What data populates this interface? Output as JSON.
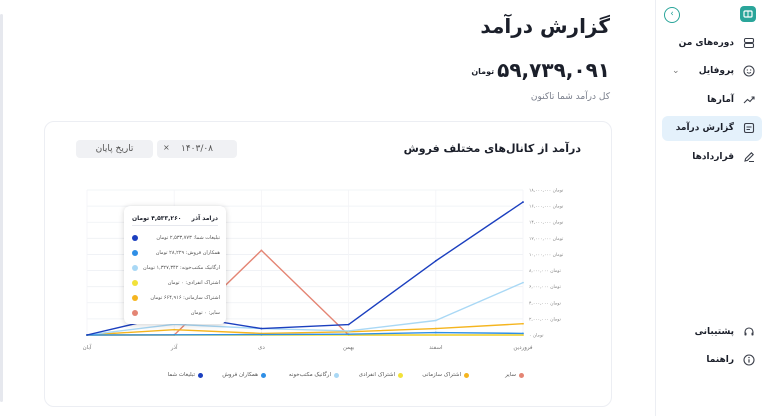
{
  "page": {
    "title": "گزارش درآمد",
    "amount": "۵۹,۷۳۹,۰۹۱",
    "currency": "تومان",
    "subtitle": "کل درآمد شما تاکنون"
  },
  "sidebar": {
    "logo_icon": "book-logo-icon",
    "collapse_icon": "chevron-right-icon",
    "items": [
      {
        "label": "دوره‌های من",
        "icon": "stack-icon"
      },
      {
        "label": "پروفایل",
        "icon": "smile-icon"
      },
      {
        "label": "آمارها",
        "icon": "trend-icon"
      },
      {
        "label": "گزارش درآمد",
        "icon": "report-icon"
      },
      {
        "label": "قراردادها",
        "icon": "pen-icon"
      }
    ],
    "bottom": [
      {
        "label": "پشتیبانی",
        "icon": "headset-icon"
      },
      {
        "label": "راهنما",
        "icon": "info-icon"
      }
    ]
  },
  "card": {
    "title": "درآمد از کانال‌های مختلف فروش",
    "start_date": "۱۴۰۳/۰۸",
    "end_date_placeholder": "تاریخ پایان",
    "clear_icon": "×"
  },
  "tooltip": {
    "title": "درامد آذر",
    "total": "۴,۵۳۳,۲۶۰ تومان",
    "rows": [
      {
        "text": "تبلیغات شما:  ۲,۵۳۳,۷۷۳ تومان",
        "color": "#1b3fbf"
      },
      {
        "text": "همکاران فروش:  ۲۸,۲۲۹ تومان",
        "color": "#2f8fe6"
      },
      {
        "text": "ارگانیک مکتب‌خونه:  ۱,۳۲۷,۳۴۲ تومان",
        "color": "#a9d8f5"
      },
      {
        "text": "اشتراک انفرادی:  ۰ تومان",
        "color": "#f2e23a"
      },
      {
        "text": "اشتراک سازمانی:  ۶۶۴,۹۱۶ تومان",
        "color": "#f5b51f"
      },
      {
        "text": "سایر:  ۰ تومان",
        "color": "#e48574"
      }
    ]
  },
  "chart_data": {
    "type": "line",
    "categories": [
      "آبان",
      "آذر",
      "دی",
      "بهمن",
      "اسفند",
      "فروردین"
    ],
    "y_tick_labels": [
      "۰ تومان",
      "۲,۰۰۰,۰۰۰ تومان",
      "۴,۰۰۰,۰۰۰ تومان",
      "۶,۰۰۰,۰۰۰ تومان",
      "۸,۰۰۰,۰۰۰ تومان",
      "۱۰,۰۰۰,۰۰۰ تومان",
      "۱۲,۰۰۰,۰۰۰ تومان",
      "۱۴,۰۰۰,۰۰۰ تومان",
      "۱۶,۰۰۰,۰۰۰ تومان",
      "۱۸,۰۰۰,۰۰۰ تومان"
    ],
    "ylim": [
      0,
      18000000
    ],
    "y_axis_position": "right",
    "grid": true,
    "legend_position": "bottom",
    "series": [
      {
        "name": "تبلیغات شما",
        "color": "#1b3fbf",
        "values": [
          0,
          2533773,
          800000,
          1300000,
          9200000,
          16500000
        ]
      },
      {
        "name": "همکاران فروش",
        "color": "#2f8fe6",
        "values": [
          0,
          28229,
          50000,
          100000,
          300000,
          200000
        ]
      },
      {
        "name": "ارگانیک مکتب‌خونه",
        "color": "#a9d8f5",
        "values": [
          0,
          1327342,
          800000,
          500000,
          1800000,
          6500000
        ]
      },
      {
        "name": "اشتراک انفرادی",
        "color": "#f2e23a",
        "values": [
          0,
          0,
          0,
          0,
          0,
          0
        ]
      },
      {
        "name": "اشتراک سازمانی",
        "color": "#f5b51f",
        "values": [
          0,
          664916,
          200000,
          400000,
          800000,
          1400000
        ]
      },
      {
        "name": "سایر",
        "color": "#e48574",
        "values": [
          0,
          0,
          10500000,
          0,
          0,
          0
        ]
      }
    ]
  }
}
